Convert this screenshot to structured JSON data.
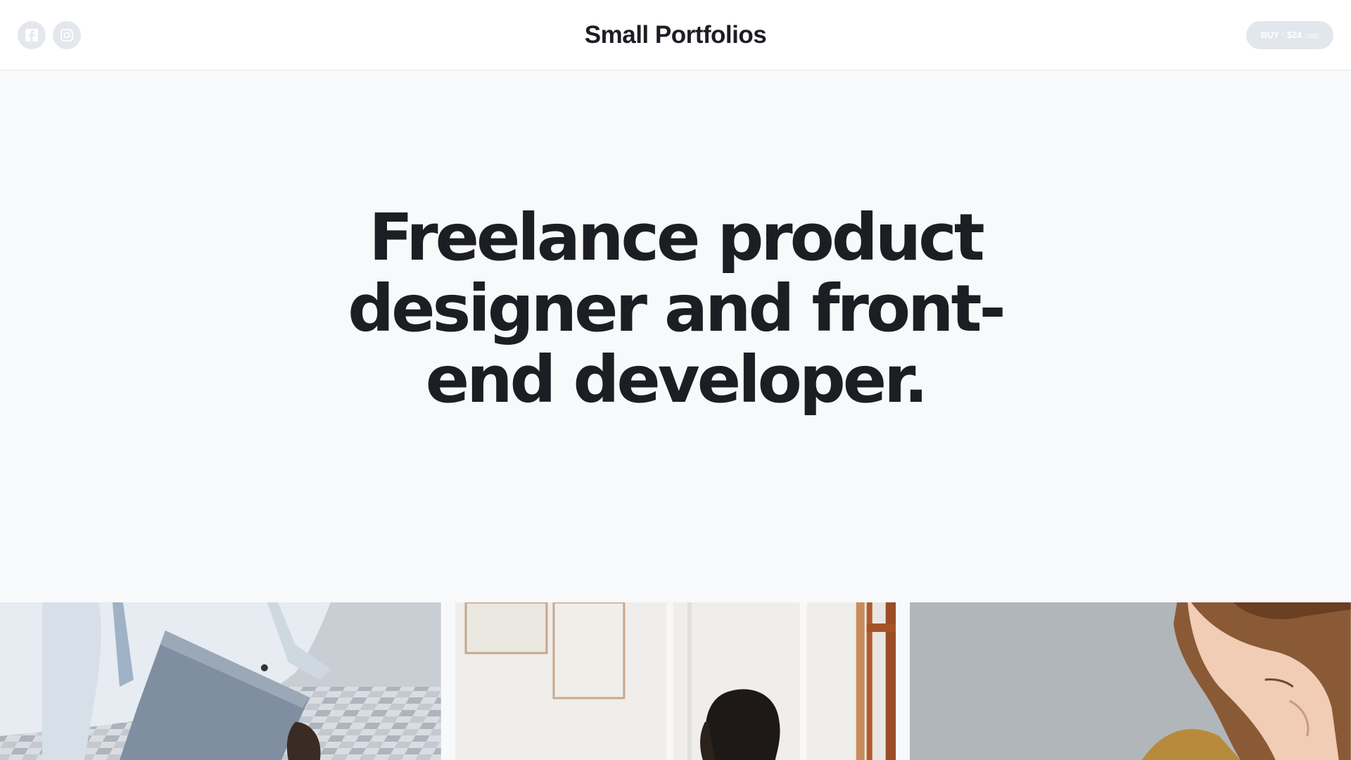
{
  "header": {
    "brand": "Small Portfolios",
    "social": [
      {
        "icon": "facebook-icon"
      },
      {
        "icon": "instagram-icon"
      }
    ],
    "buy": {
      "label": "BUY · $24",
      "currency": "USD"
    }
  },
  "hero": {
    "title": "Freelance product designer and front-end developer."
  },
  "gallery": {
    "tiles": [
      {
        "subject": "person-holding-laptop"
      },
      {
        "subject": "woman-in-white-room"
      },
      {
        "subject": "man-with-curly-hair"
      }
    ]
  },
  "colors": {
    "page_bg": "#f8f9fb",
    "header_bg": "#ffffff",
    "text": "#1c1e24",
    "button_bg": "#e2e6ed",
    "icon_bg": "#e4e7ec"
  }
}
